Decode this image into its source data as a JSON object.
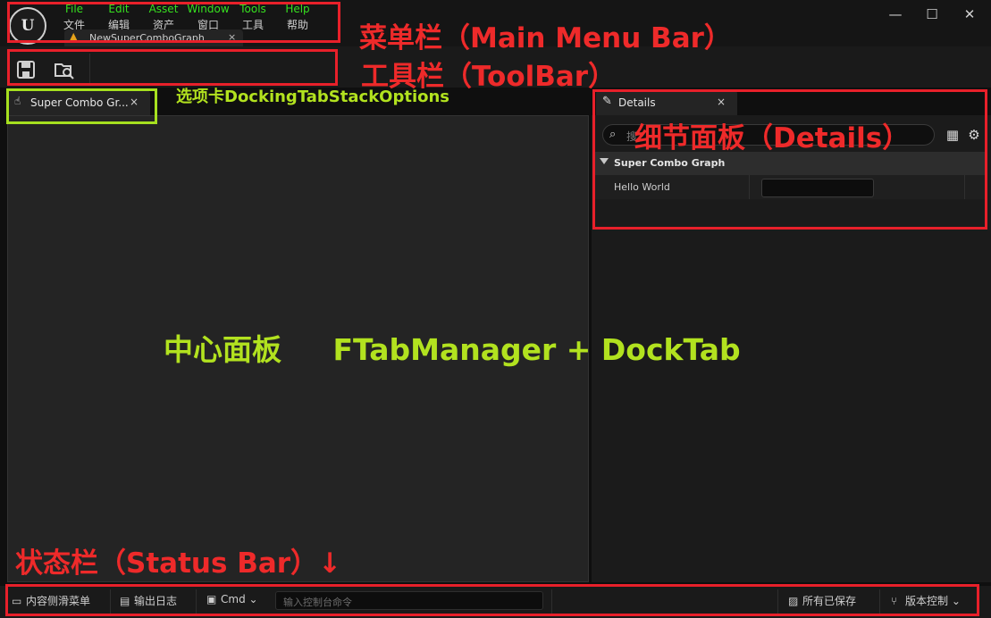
{
  "logo": {
    "text": "U"
  },
  "menu": [
    {
      "en": "File",
      "zh": "文件"
    },
    {
      "en": "Edit",
      "zh": "编辑"
    },
    {
      "en": "Asset",
      "zh": "资产"
    },
    {
      "en": "Window",
      "zh": "窗口"
    },
    {
      "en": "Tools",
      "zh": "工具"
    },
    {
      "en": "Help",
      "zh": "帮助"
    }
  ],
  "asset_tab": {
    "label": "NewSuperComboGraph",
    "close": "×"
  },
  "window_controls": {
    "minimize": "—",
    "maximize": "☐",
    "close": "✕"
  },
  "toolbar": {
    "save_icon": "save-icon",
    "browse_icon": "browse-icon"
  },
  "dock_tab": {
    "label": "Super Combo Gr...",
    "close": "×"
  },
  "details": {
    "tab_label": "Details",
    "close": "×",
    "search_placeholder": "搜",
    "category": "Super Combo Graph",
    "property_name": "Hello World",
    "property_value": ""
  },
  "status_bar": {
    "content_drawer": "内容侧滑菜单",
    "output_log": "输出日志",
    "cmd": "Cmd",
    "console_placeholder": "输入控制台命令",
    "all_saved": "所有已保存",
    "source_control": "版本控制"
  },
  "annotations": {
    "menu_bar": "菜单栏（Main Menu Bar）",
    "toolbar": "工具栏（ToolBar）",
    "docking_tab": "选项卡DockingTabStackOptions",
    "details": "细节面板（Details）",
    "center": "中心面板     FTabManager + DockTab",
    "status_bar": "状态栏（Status Bar）↓"
  },
  "colors": {
    "annotation_red": "#e8202a",
    "annotation_green": "#a6e01f",
    "menu_en": "#37e01f"
  }
}
